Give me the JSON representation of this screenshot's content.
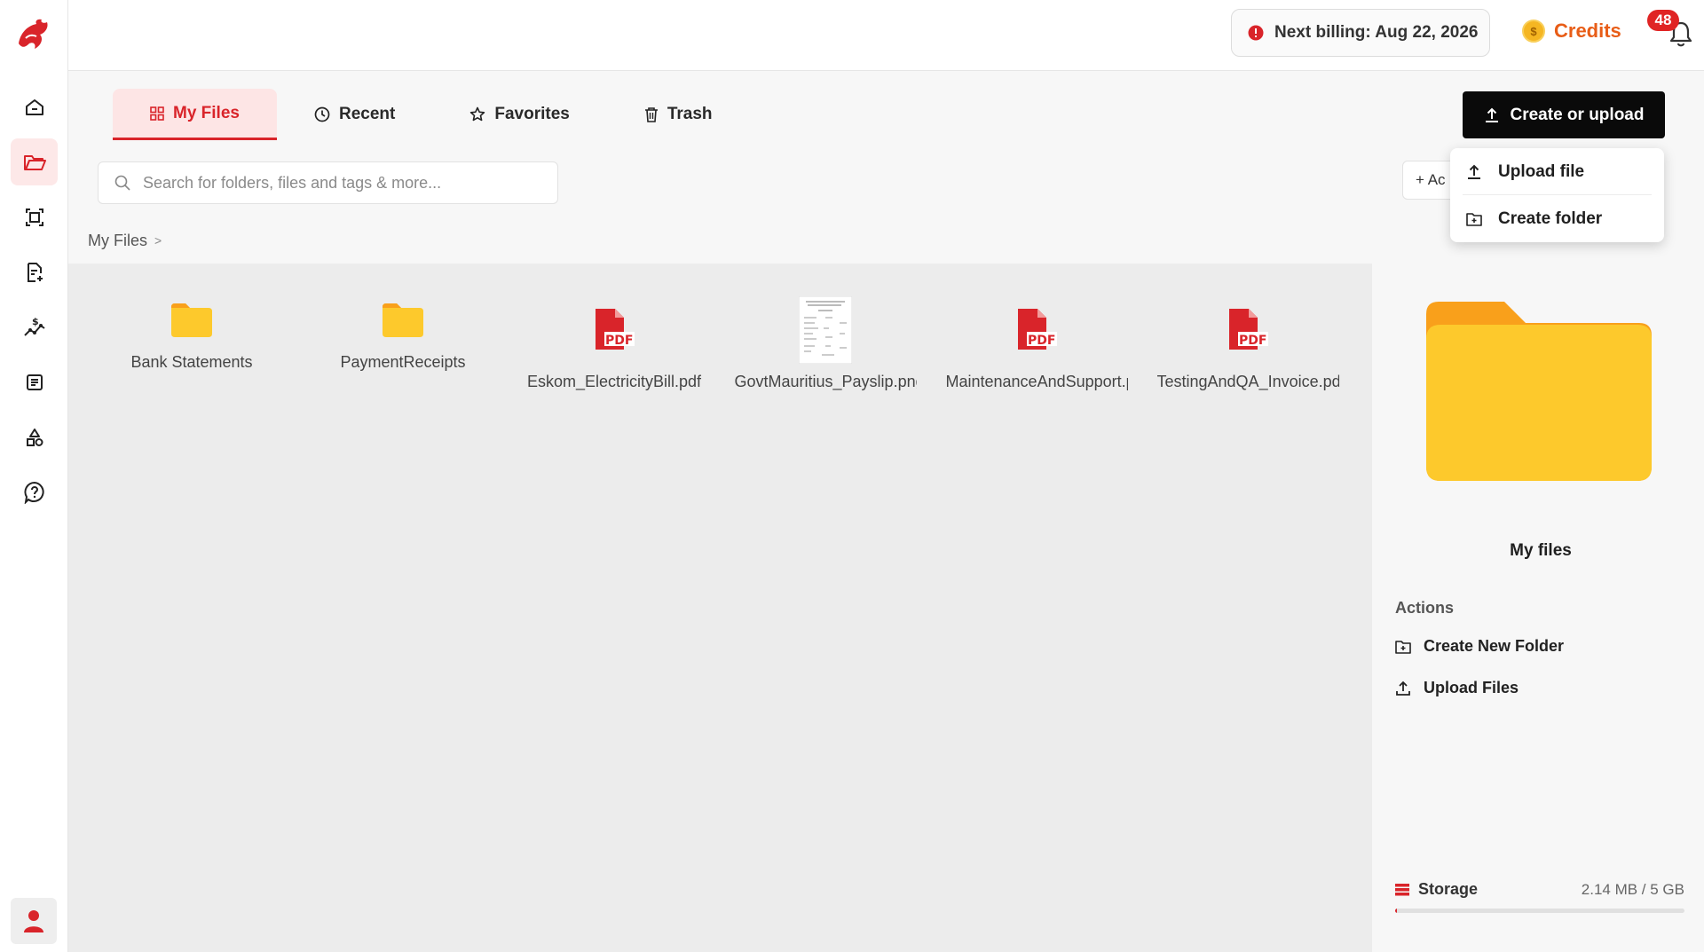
{
  "topbar": {
    "billing_text": "Next billing: Aug 22, 2026",
    "credits_label": "Credits",
    "coin_symbol": "$",
    "notification_count": "48"
  },
  "tabs": [
    {
      "label": "My Files",
      "icon": "grid-icon",
      "active": true
    },
    {
      "label": "Recent",
      "icon": "clock-icon",
      "active": false
    },
    {
      "label": "Favorites",
      "icon": "star-icon",
      "active": false
    },
    {
      "label": "Trash",
      "icon": "trash-icon",
      "active": false
    }
  ],
  "create_button": {
    "label": "Create or upload"
  },
  "dropdown": {
    "upload_file": "Upload file",
    "create_folder": "Create folder"
  },
  "search": {
    "placeholder": "Search for folders, files and tags & more..."
  },
  "add_button": {
    "label": "+ Ac"
  },
  "breadcrumb": {
    "root": "My Files",
    "separator": ">"
  },
  "files": [
    {
      "name": "Bank Statements",
      "kind": "folder"
    },
    {
      "name": "PaymentReceipts",
      "kind": "folder"
    },
    {
      "name": "Eskom_ElectricityBill.pdf",
      "kind": "pdf"
    },
    {
      "name": "GovtMauritius_Payslip.png",
      "kind": "image"
    },
    {
      "name": "MaintenanceAndSupport.pdf",
      "kind": "pdf"
    },
    {
      "name": "TestingAndQA_Invoice.pdf",
      "kind": "pdf"
    }
  ],
  "pdf_label": "PDF",
  "details": {
    "title": "My files",
    "actions_label": "Actions",
    "create_new_folder": "Create New Folder",
    "upload_files": "Upload Files",
    "storage_label": "Storage",
    "storage_value": "2.14 MB / 5 GB",
    "storage_fraction": 0.0004
  },
  "colors": {
    "accent_red": "#d9242a",
    "folder_yellow": "#fdc92c",
    "folder_orange": "#f9a01b",
    "credits_orange": "#e85d17"
  }
}
